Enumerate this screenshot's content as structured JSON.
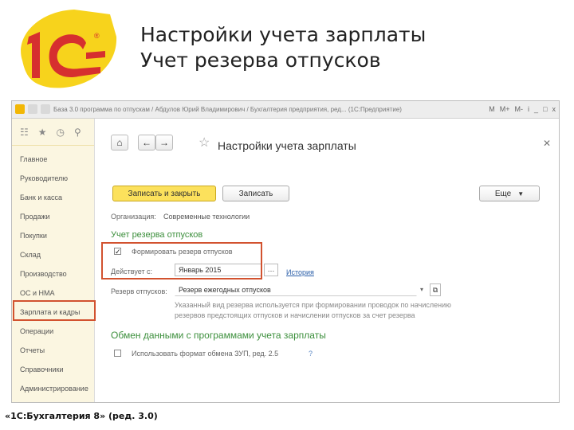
{
  "slide": {
    "title_line1": "Настройки учета зарплаты",
    "title_line2": "Учет резерва отпусков",
    "caption": "«1С:Бухгалтерия 8» (ред. 3.0)"
  },
  "logo": {
    "text": "1С",
    "mark": "®"
  },
  "window": {
    "title": "База 3.0 программа по отпускам / Абдулов Юрий Владимирович / Бухгалтерия предприятия, ред... (1С:Предприятие)",
    "right_icons": [
      "M",
      "M+",
      "M-",
      "i",
      "_",
      "□",
      "x"
    ]
  },
  "sidebar": {
    "items": [
      "Главное",
      "Руководителю",
      "Банк и касса",
      "Продажи",
      "Покупки",
      "Склад",
      "Производство",
      "ОС и НМА",
      "Зарплата и кадры",
      "Операции",
      "Отчеты",
      "Справочники",
      "Администрирование"
    ]
  },
  "form": {
    "title": "Настройки учета зарплаты",
    "save_close_label": "Записать и закрыть",
    "save_label": "Записать",
    "more_label": "Еще",
    "org_label": "Организация:",
    "org_value": "Современные технологии",
    "reserve_section": "Учет резерва отпусков",
    "form_reserve_label": "Формировать резерв отпусков",
    "form_reserve_checked": "✓",
    "valid_from_label": "Действует с:",
    "valid_from_value": "Январь 2015",
    "history_link": "История",
    "reserve_type_label": "Резерв отпусков:",
    "reserve_type_value": "Резерв ежегодных отпусков",
    "hint_line1": "Указанный вид резерва используется при формировании проводок по начислению",
    "hint_line2": "резервов предстоящих отпусков и начислении отпусков за счет резерва",
    "exchange_section": "Обмен данными с программами учета зарплаты",
    "use_format_label": "Использовать формат обмена ЗУП, ред. 2.5",
    "help_mark": "?"
  },
  "colors": {
    "accent_yellow": "#fce15c",
    "section_green": "#3c8f3c",
    "highlight_red": "#d2522f",
    "logo_red": "#d62f2f",
    "logo_yellow": "#f7d31c"
  }
}
